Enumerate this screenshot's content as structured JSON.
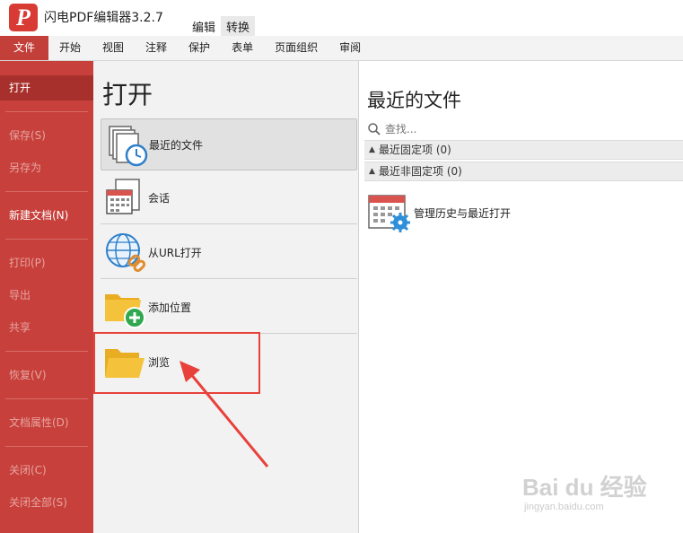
{
  "app": {
    "logo_letter": "P",
    "title": "闪电PDF编辑器3.2.7",
    "title_tabs": [
      "编辑",
      "转换"
    ]
  },
  "menu": {
    "items": [
      "文件",
      "开始",
      "视图",
      "注释",
      "保护",
      "表单",
      "页面组织",
      "审阅"
    ]
  },
  "leftnav": {
    "items": [
      {
        "label": "打开",
        "state": "active"
      },
      {
        "label": "保存(S)",
        "state": "disabled"
      },
      {
        "label": "另存为",
        "state": "disabled"
      },
      {
        "label": "新建文档(N)",
        "state": "enabled"
      },
      {
        "label": "打印(P)",
        "state": "disabled"
      },
      {
        "label": "导出",
        "state": "disabled"
      },
      {
        "label": "共享",
        "state": "disabled"
      },
      {
        "label": "恢复(V)",
        "state": "disabled"
      },
      {
        "label": "文档属性(D)",
        "state": "disabled"
      },
      {
        "label": "关闭(C)",
        "state": "disabled"
      },
      {
        "label": "关闭全部(S)",
        "state": "disabled"
      }
    ]
  },
  "open_panel": {
    "heading": "打开",
    "items": [
      {
        "label": "最近的文件",
        "icon": "recent-files-clock-icon",
        "selected": true
      },
      {
        "label": "会话",
        "icon": "session-calendar-icon",
        "selected": false
      },
      {
        "label": "从URL打开",
        "icon": "globe-link-icon",
        "selected": false
      },
      {
        "label": "添加位置",
        "icon": "folder-add-icon",
        "selected": false
      },
      {
        "label": "浏览",
        "icon": "folder-open-icon",
        "selected": false
      }
    ]
  },
  "recent_panel": {
    "heading": "最近的文件",
    "search_placeholder": "查找...",
    "groups": [
      {
        "label": "最近固定项",
        "count": "(0)"
      },
      {
        "label": "最近非固定项",
        "count": "(0)"
      }
    ],
    "manage_label": "管理历史与最近打开"
  },
  "watermark": {
    "text": "Bai du 经验",
    "sub": "jingyan.baidu.com"
  },
  "colors": {
    "accent_red": "#c7403b",
    "annotation_red": "#e8413b",
    "folder_yellow": "#f5c33b"
  }
}
